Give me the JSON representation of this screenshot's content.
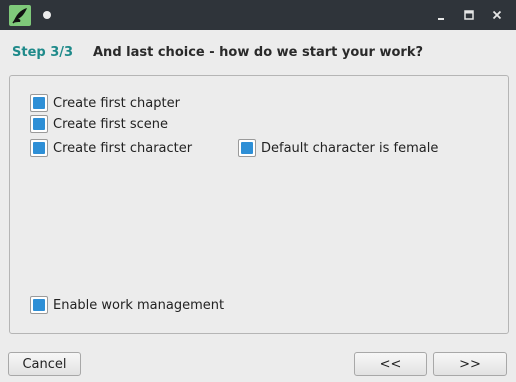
{
  "window": {
    "app_icon": "quill-icon",
    "controls": {
      "minimize_icon": "minimize-icon",
      "maximize_icon": "maximize-icon",
      "close_icon": "close-icon"
    }
  },
  "wizard": {
    "step_label": "Step 3/3",
    "title": "And last choice - how do we start your work?"
  },
  "options": [
    {
      "label": "Create first chapter",
      "checked": true
    },
    {
      "label": "Create first scene",
      "checked": true
    },
    {
      "label": "Create first character",
      "checked": true
    },
    {
      "label": "Default character is female",
      "checked": true
    },
    {
      "label": "Enable work management",
      "checked": true
    }
  ],
  "buttons": {
    "cancel": "Cancel",
    "back": "<<",
    "next": ">>"
  },
  "colors": {
    "titlebar": "#2f343a",
    "step_accent": "#1f8a8a",
    "checkbox_fill": "#2e8fd6"
  }
}
